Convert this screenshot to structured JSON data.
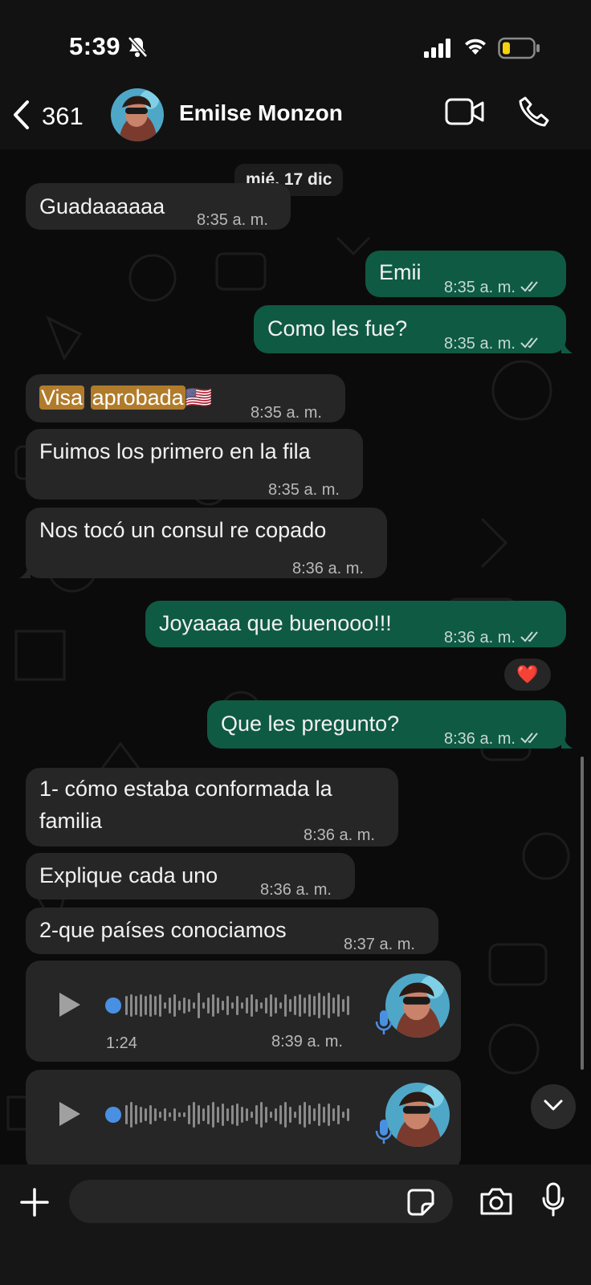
{
  "status_bar": {
    "time": "5:39",
    "icons": [
      "bell-slash-icon",
      "cellular-signal-icon",
      "wifi-icon",
      "battery-low-icon"
    ]
  },
  "header": {
    "back_count": "361",
    "contact_name": "Emilse Monzon",
    "icons": [
      "chevron-left-icon",
      "video-call-icon",
      "phone-icon"
    ]
  },
  "chat": {
    "date_label": "mié, 17 dic",
    "messages": [
      {
        "dir": "in",
        "text": "Guadaaaaaa",
        "time": "8:35 a. m."
      },
      {
        "dir": "out",
        "text": "Emii",
        "time": "8:35 a. m.",
        "status": "read"
      },
      {
        "dir": "out",
        "text": "Como les fue?",
        "time": "8:35 a. m.",
        "status": "read"
      },
      {
        "dir": "in",
        "text_parts": [
          "Visa",
          "aprobada",
          "🇺🇸"
        ],
        "time": "8:35 a. m."
      },
      {
        "dir": "in",
        "text": "Fuimos los primero en la fila",
        "time": "8:35 a. m."
      },
      {
        "dir": "in",
        "text": "Nos tocó un consul re copado",
        "time": "8:36 a. m."
      },
      {
        "dir": "out",
        "text": "Joyaaaa que buenooo!!!",
        "time": "8:36 a. m.",
        "status": "read",
        "reaction": "❤️"
      },
      {
        "dir": "out",
        "text": "Que les pregunto?",
        "time": "8:36 a. m.",
        "status": "read"
      },
      {
        "dir": "in",
        "text_lines": [
          "1- cómo estaba conformada la",
          "familia"
        ],
        "time": "8:36 a. m."
      },
      {
        "dir": "in",
        "text": "Explique cada uno",
        "time": "8:36 a. m."
      },
      {
        "dir": "in",
        "text": "2-que países conociamos",
        "time": "8:37 a. m."
      }
    ],
    "voice_notes": [
      {
        "duration": "1:24",
        "time": "8:39 a. m."
      },
      {
        "duration": "",
        "time": ""
      }
    ]
  },
  "input_bar": {
    "placeholder": "",
    "icons": [
      "plus-icon",
      "sticker-icon",
      "camera-icon",
      "microphone-icon"
    ]
  }
}
